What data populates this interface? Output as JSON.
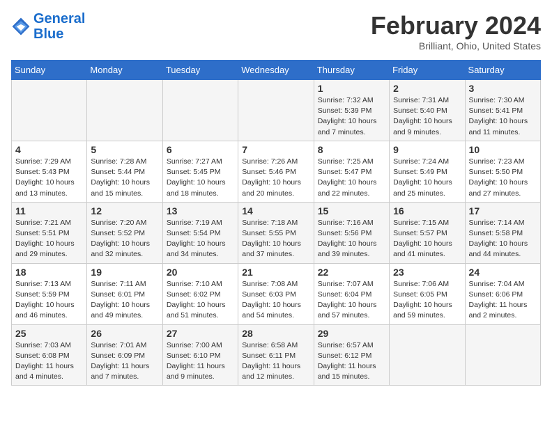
{
  "header": {
    "logo_line1": "General",
    "logo_line2": "Blue",
    "month_year": "February 2024",
    "location": "Brilliant, Ohio, United States"
  },
  "weekdays": [
    "Sunday",
    "Monday",
    "Tuesday",
    "Wednesday",
    "Thursday",
    "Friday",
    "Saturday"
  ],
  "weeks": [
    [
      {
        "day": "",
        "info": ""
      },
      {
        "day": "",
        "info": ""
      },
      {
        "day": "",
        "info": ""
      },
      {
        "day": "",
        "info": ""
      },
      {
        "day": "1",
        "info": "Sunrise: 7:32 AM\nSunset: 5:39 PM\nDaylight: 10 hours and 7 minutes."
      },
      {
        "day": "2",
        "info": "Sunrise: 7:31 AM\nSunset: 5:40 PM\nDaylight: 10 hours and 9 minutes."
      },
      {
        "day": "3",
        "info": "Sunrise: 7:30 AM\nSunset: 5:41 PM\nDaylight: 10 hours and 11 minutes."
      }
    ],
    [
      {
        "day": "4",
        "info": "Sunrise: 7:29 AM\nSunset: 5:43 PM\nDaylight: 10 hours and 13 minutes."
      },
      {
        "day": "5",
        "info": "Sunrise: 7:28 AM\nSunset: 5:44 PM\nDaylight: 10 hours and 15 minutes."
      },
      {
        "day": "6",
        "info": "Sunrise: 7:27 AM\nSunset: 5:45 PM\nDaylight: 10 hours and 18 minutes."
      },
      {
        "day": "7",
        "info": "Sunrise: 7:26 AM\nSunset: 5:46 PM\nDaylight: 10 hours and 20 minutes."
      },
      {
        "day": "8",
        "info": "Sunrise: 7:25 AM\nSunset: 5:47 PM\nDaylight: 10 hours and 22 minutes."
      },
      {
        "day": "9",
        "info": "Sunrise: 7:24 AM\nSunset: 5:49 PM\nDaylight: 10 hours and 25 minutes."
      },
      {
        "day": "10",
        "info": "Sunrise: 7:23 AM\nSunset: 5:50 PM\nDaylight: 10 hours and 27 minutes."
      }
    ],
    [
      {
        "day": "11",
        "info": "Sunrise: 7:21 AM\nSunset: 5:51 PM\nDaylight: 10 hours and 29 minutes."
      },
      {
        "day": "12",
        "info": "Sunrise: 7:20 AM\nSunset: 5:52 PM\nDaylight: 10 hours and 32 minutes."
      },
      {
        "day": "13",
        "info": "Sunrise: 7:19 AM\nSunset: 5:54 PM\nDaylight: 10 hours and 34 minutes."
      },
      {
        "day": "14",
        "info": "Sunrise: 7:18 AM\nSunset: 5:55 PM\nDaylight: 10 hours and 37 minutes."
      },
      {
        "day": "15",
        "info": "Sunrise: 7:16 AM\nSunset: 5:56 PM\nDaylight: 10 hours and 39 minutes."
      },
      {
        "day": "16",
        "info": "Sunrise: 7:15 AM\nSunset: 5:57 PM\nDaylight: 10 hours and 41 minutes."
      },
      {
        "day": "17",
        "info": "Sunrise: 7:14 AM\nSunset: 5:58 PM\nDaylight: 10 hours and 44 minutes."
      }
    ],
    [
      {
        "day": "18",
        "info": "Sunrise: 7:13 AM\nSunset: 5:59 PM\nDaylight: 10 hours and 46 minutes."
      },
      {
        "day": "19",
        "info": "Sunrise: 7:11 AM\nSunset: 6:01 PM\nDaylight: 10 hours and 49 minutes."
      },
      {
        "day": "20",
        "info": "Sunrise: 7:10 AM\nSunset: 6:02 PM\nDaylight: 10 hours and 51 minutes."
      },
      {
        "day": "21",
        "info": "Sunrise: 7:08 AM\nSunset: 6:03 PM\nDaylight: 10 hours and 54 minutes."
      },
      {
        "day": "22",
        "info": "Sunrise: 7:07 AM\nSunset: 6:04 PM\nDaylight: 10 hours and 57 minutes."
      },
      {
        "day": "23",
        "info": "Sunrise: 7:06 AM\nSunset: 6:05 PM\nDaylight: 10 hours and 59 minutes."
      },
      {
        "day": "24",
        "info": "Sunrise: 7:04 AM\nSunset: 6:06 PM\nDaylight: 11 hours and 2 minutes."
      }
    ],
    [
      {
        "day": "25",
        "info": "Sunrise: 7:03 AM\nSunset: 6:08 PM\nDaylight: 11 hours and 4 minutes."
      },
      {
        "day": "26",
        "info": "Sunrise: 7:01 AM\nSunset: 6:09 PM\nDaylight: 11 hours and 7 minutes."
      },
      {
        "day": "27",
        "info": "Sunrise: 7:00 AM\nSunset: 6:10 PM\nDaylight: 11 hours and 9 minutes."
      },
      {
        "day": "28",
        "info": "Sunrise: 6:58 AM\nSunset: 6:11 PM\nDaylight: 11 hours and 12 minutes."
      },
      {
        "day": "29",
        "info": "Sunrise: 6:57 AM\nSunset: 6:12 PM\nDaylight: 11 hours and 15 minutes."
      },
      {
        "day": "",
        "info": ""
      },
      {
        "day": "",
        "info": ""
      }
    ]
  ]
}
